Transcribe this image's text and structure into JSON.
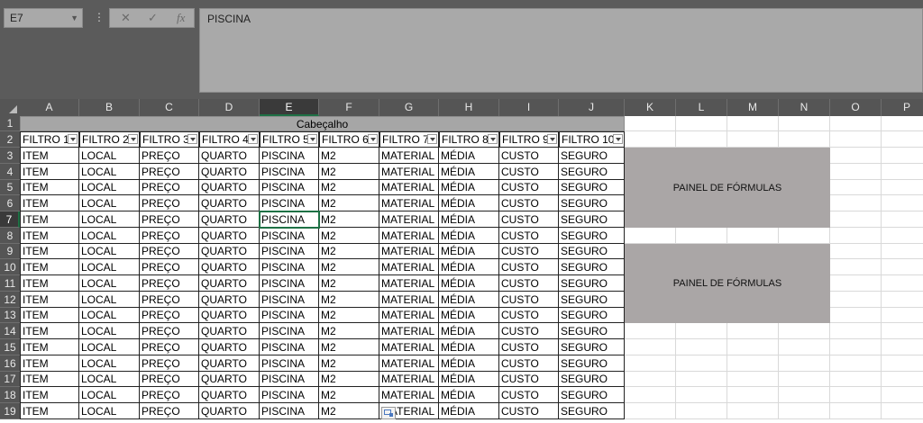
{
  "namebox": {
    "value": "E7"
  },
  "formula_bar": {
    "value": "PISCINA"
  },
  "icons": {
    "cancel": "close-icon",
    "confirm": "check-icon",
    "function": "fx-icon"
  },
  "columns": [
    "A",
    "B",
    "C",
    "D",
    "E",
    "F",
    "G",
    "H",
    "I",
    "J",
    "K",
    "L",
    "M",
    "N",
    "O",
    "P"
  ],
  "rows": [
    "1",
    "2",
    "3",
    "4",
    "5",
    "6",
    "7",
    "8",
    "9",
    "10",
    "11",
    "12",
    "13",
    "14",
    "15",
    "16",
    "17",
    "18",
    "19"
  ],
  "header_band": "Cabeçalho",
  "filters": [
    "FILTRO 1",
    "FILTRO 2",
    "FILTRO 3",
    "FILTRO 4",
    "FILTRO 5",
    "FILTRO 6",
    "FILTRO 7",
    "FILTRO 8",
    "FILTRO 9",
    "FILTRO 10"
  ],
  "row_values": [
    "ITEM",
    "LOCAL",
    "PREÇO",
    "QUARTO",
    "PISCINA",
    "M2",
    "MATERIAL",
    "MÉDIA",
    "CUSTO",
    "SEGURO"
  ],
  "data_row_count": 17,
  "panels": [
    "PAINEL DE FÓRMULAS",
    "PAINEL DE FÓRMULAS"
  ],
  "active_cell": "E7",
  "colors": {
    "accent": "#1e7145",
    "panel": "#aaa6a6",
    "header_band": "#a6a6a6"
  }
}
